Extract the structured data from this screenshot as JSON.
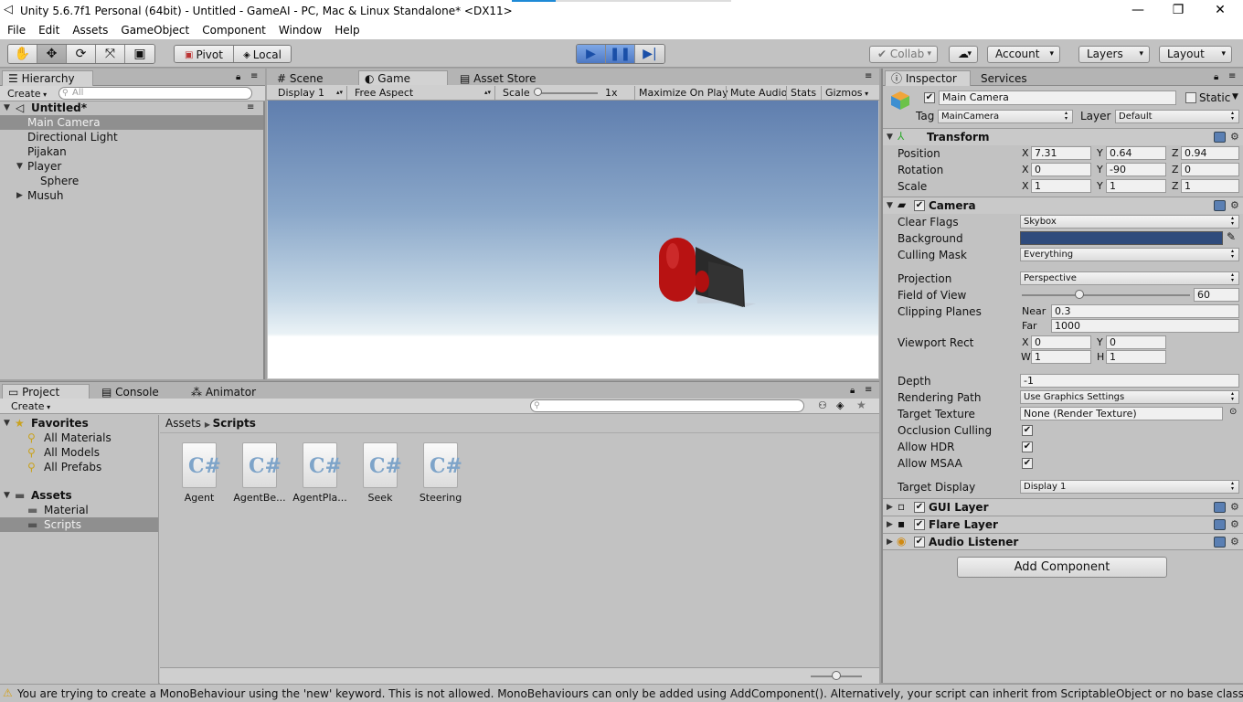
{
  "window": {
    "title": "Unity 5.6.7f1 Personal (64bit) - Untitled - GameAI - PC, Mac & Linux Standalone* <DX11>",
    "minimize": "—",
    "maximize": "❐",
    "close": "✕"
  },
  "menu": [
    "File",
    "Edit",
    "Assets",
    "GameObject",
    "Component",
    "Window",
    "Help"
  ],
  "toolbar": {
    "pivot": "Pivot",
    "local": "Local",
    "collab": "Collab",
    "account": "Account",
    "layers": "Layers",
    "layout": "Layout"
  },
  "hierarchy": {
    "tab": "Hierarchy",
    "create": "Create",
    "search_placeholder": "All",
    "scene": "Untitled*",
    "items": [
      "Main Camera",
      "Directional Light",
      "Pijakan",
      "Player",
      "Sphere",
      "Musuh"
    ]
  },
  "views": {
    "tabs": [
      "Scene",
      "Game",
      "Asset Store"
    ],
    "display": "Display 1",
    "aspect": "Free Aspect",
    "scale_label": "Scale",
    "scale_value": "1x",
    "maximize": "Maximize On Play",
    "mute": "Mute Audio",
    "stats": "Stats",
    "gizmos": "Gizmos"
  },
  "project": {
    "tabs": [
      "Project",
      "Console",
      "Animator"
    ],
    "create": "Create",
    "favorites": "Favorites",
    "fav_items": [
      "All Materials",
      "All Models",
      "All Prefabs"
    ],
    "assets": "Assets",
    "folders": [
      "Material",
      "Scripts"
    ],
    "breadcrumb": [
      "Assets",
      "Scripts"
    ],
    "scripts": [
      "Agent",
      "AgentBe...",
      "AgentPla...",
      "Seek",
      "Steering"
    ],
    "cs_glyph": "C#"
  },
  "inspector": {
    "tabs": [
      "Inspector",
      "Services"
    ],
    "name": "Main Camera",
    "static": "Static",
    "tag_label": "Tag",
    "tag": "MainCamera",
    "layer_label": "Layer",
    "layer": "Default",
    "transform": {
      "title": "Transform",
      "position_label": "Position",
      "position": [
        "7.31",
        "0.64",
        "0.94"
      ],
      "rotation_label": "Rotation",
      "rotation": [
        "0",
        "-90",
        "0"
      ],
      "scale_label": "Scale",
      "scale": [
        "1",
        "1",
        "1"
      ]
    },
    "camera": {
      "title": "Camera",
      "clear_flags_label": "Clear Flags",
      "clear_flags": "Skybox",
      "background_label": "Background",
      "culling_label": "Culling Mask",
      "culling": "Everything",
      "projection_label": "Projection",
      "projection": "Perspective",
      "fov_label": "Field of View",
      "fov": "60",
      "fov_fraction": 0.34,
      "clipping_label": "Clipping Planes",
      "near_label": "Near",
      "near": "0.3",
      "far_label": "Far",
      "far": "1000",
      "viewport_label": "Viewport Rect",
      "vx": "0",
      "vy": "0",
      "vw": "1",
      "vh": "1",
      "depth_label": "Depth",
      "depth": "-1",
      "rendering_label": "Rendering Path",
      "rendering": "Use Graphics Settings",
      "target_label": "Target Texture",
      "target": "None (Render Texture)",
      "occlusion_label": "Occlusion Culling",
      "hdr_label": "Allow HDR",
      "msaa_label": "Allow MSAA",
      "display_label": "Target Display",
      "display": "Display 1"
    },
    "components": [
      "GUI Layer",
      "Flare Layer",
      "Audio Listener"
    ],
    "add_component": "Add Component",
    "axes": [
      "X",
      "Y",
      "Z",
      "W",
      "H"
    ]
  },
  "status": "You are trying to create a MonoBehaviour using the 'new' keyword.  This is not allowed.  MonoBehaviours can only be added using AddComponent().  Alternatively, your script can inherit from ScriptableObject or no base class at all",
  "colors": {
    "camera_background": "#2f4b7c",
    "play_blue": "#4e79c4",
    "selection": "#8f8f8f"
  }
}
